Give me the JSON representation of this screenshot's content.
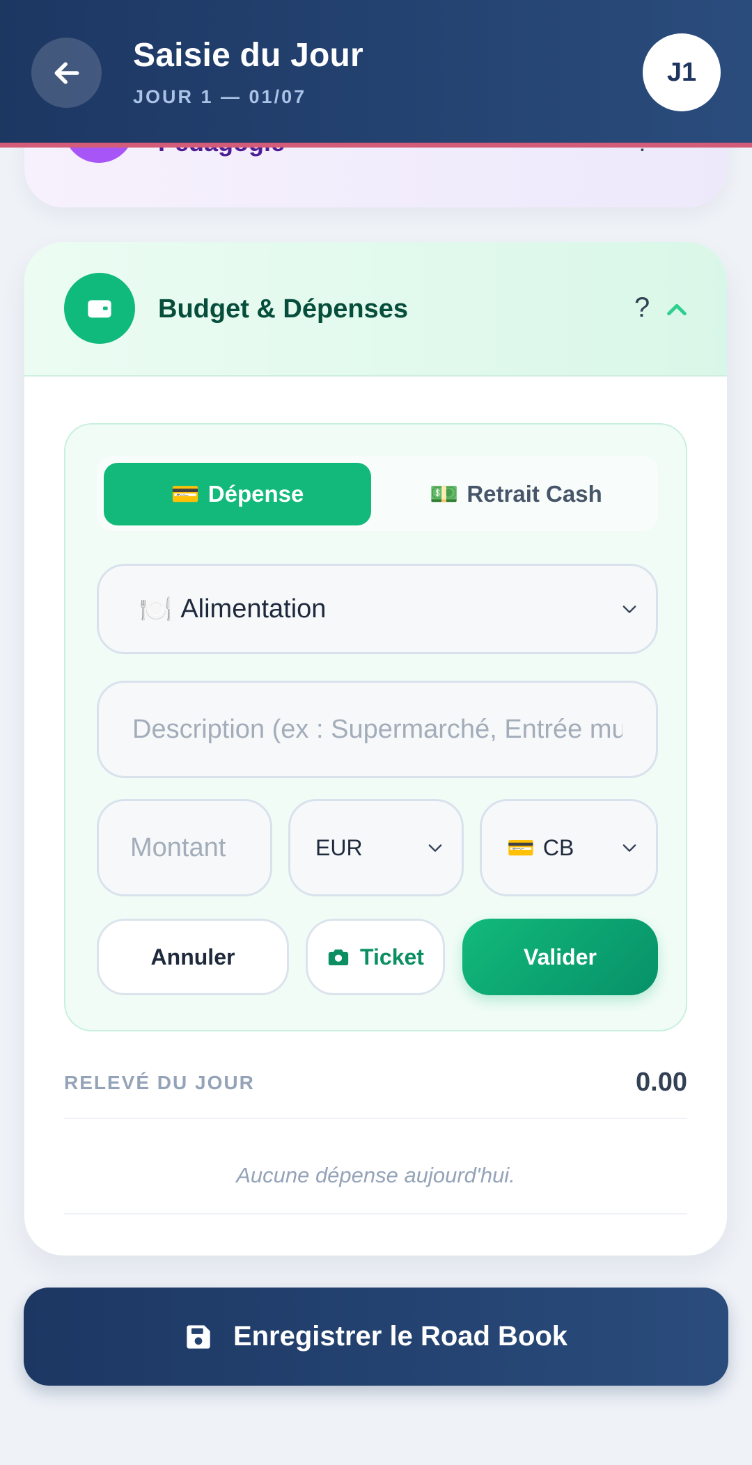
{
  "header": {
    "title": "Saisie du Jour",
    "subtitle": "JOUR 1 — 01/07",
    "avatar": "J1",
    "back_icon": "arrow-left-icon"
  },
  "peek_card": {
    "label": "Pédagogie",
    "help": "?"
  },
  "budget": {
    "title": "Budget & Dépenses",
    "help": "?",
    "accent": "#10b97c",
    "tabs": [
      {
        "emoji": "💳",
        "label": "Dépense",
        "active": true
      },
      {
        "emoji": "💵",
        "label": "Retrait Cash",
        "active": false
      }
    ],
    "category": {
      "emoji": "🍽️",
      "value": "Alimentation"
    },
    "description_placeholder": "Description (ex : Supermarché, Entrée musée...)",
    "amount_placeholder": "Montant",
    "currency": "EUR",
    "payment": {
      "emoji": "💳",
      "value": "CB"
    },
    "buttons": {
      "cancel": "Annuler",
      "ticket": "Ticket",
      "validate": "Valider"
    },
    "statement_label": "RELEVÉ DU JOUR",
    "statement_total": "0.00",
    "empty_message": "Aucune dépense aujourd'hui."
  },
  "save_button": "Enregistrer le Road Book"
}
